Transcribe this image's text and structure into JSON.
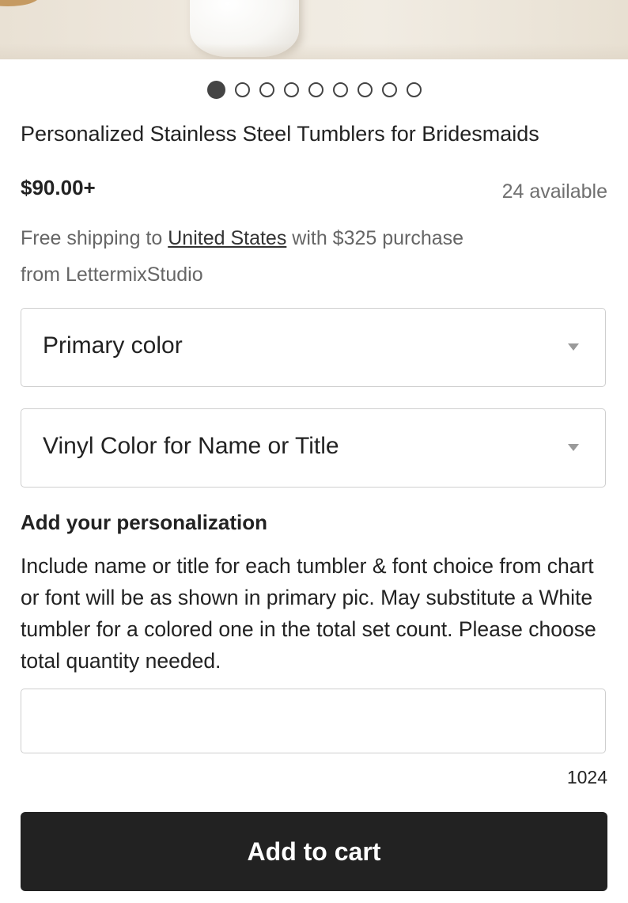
{
  "gallery": {
    "image_count": 9,
    "active_index": 0
  },
  "product": {
    "title": "Personalized Stainless Steel Tumblers for Bridesmaids",
    "price": "$90.00+",
    "availability": "24 available"
  },
  "shipping": {
    "prefix": "Free shipping to",
    "country_link": "United States",
    "suffix": "with $325 purchase",
    "from_line": "from LettermixStudio"
  },
  "options": {
    "primary_color": {
      "label": "Primary color"
    },
    "vinyl_color": {
      "label": "Vinyl Color for Name or Title"
    }
  },
  "personalization": {
    "heading": "Add your personalization",
    "description": "Include name or title for each tumbler & font choice from chart or font will be as shown in primary pic. May substitute a White tumbler for a colored one in the total set count. Please choose total quantity needed.",
    "value": "",
    "char_remaining": "1024"
  },
  "cart": {
    "button_label": "Add to cart"
  },
  "colors": {
    "button_bg": "#222222",
    "muted_text": "#707070",
    "border": "#cfcfcf"
  }
}
